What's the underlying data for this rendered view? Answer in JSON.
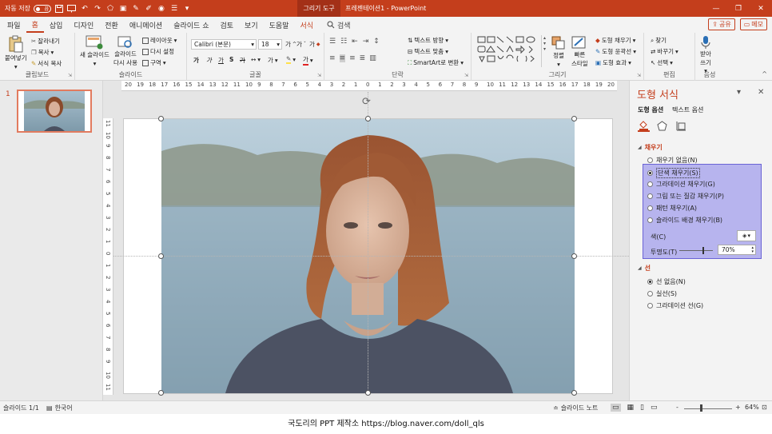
{
  "titlebar": {
    "autosave_label": "자동 저장",
    "autosave_state": "끔",
    "context_tab": "그리기 도구",
    "document_title": "프레젠테이션1 - PowerPoint",
    "window_buttons": [
      "—",
      "❐",
      "✕"
    ]
  },
  "tabs": {
    "items": [
      "파일",
      "홈",
      "삽입",
      "디자인",
      "전환",
      "애니메이션",
      "슬라이드 쇼",
      "검토",
      "보기",
      "도움말",
      "서식"
    ],
    "active": "홈",
    "context": "서식",
    "search_label": "검색",
    "share_label": "공유",
    "comments_label": "메모"
  },
  "ribbon": {
    "clipboard": {
      "label": "클립보드",
      "paste": "붙여넣기",
      "cut": "잘라내기",
      "copy": "복사",
      "format_painter": "서식 복사"
    },
    "slides": {
      "label": "슬라이드",
      "new_slide": "새 슬라이드",
      "reuse_1": "슬라이드",
      "reuse_2": "다시 사용",
      "layout": "레이아웃",
      "reset": "다시 설정",
      "section": "구역"
    },
    "font": {
      "label": "글꼴",
      "font_name": "Calibri (본문)",
      "font_size": "18",
      "grow": "가",
      "shrink": "가",
      "clear": "가",
      "bold": "가",
      "italic": "가",
      "underline": "가",
      "strike": "S",
      "char_spacing": "가",
      "change_case": "가",
      "font_color": "가"
    },
    "paragraph": {
      "label": "단락",
      "text_direction": "텍스트 방향",
      "align_text": "텍스트 맞춤",
      "smartart": "SmartArt로 변환"
    },
    "drawing": {
      "label": "그리기",
      "arrange": "정렬",
      "quick_styles_1": "빠른",
      "quick_styles_2": "스타일",
      "shape_fill": "도형 채우기",
      "shape_outline": "도형 윤곽선",
      "shape_effects": "도형 효과"
    },
    "editing": {
      "label": "편집",
      "find": "찾기",
      "replace": "바꾸기",
      "select": "선택"
    },
    "voice": {
      "label": "음성",
      "dictate_1": "받아",
      "dictate_2": "쓰기"
    }
  },
  "thumbnails": {
    "slide_number": "1"
  },
  "rulers": {
    "horizontal": [
      "20",
      "19",
      "18",
      "17",
      "16",
      "15",
      "14",
      "13",
      "12",
      "11",
      "10",
      "9",
      "8",
      "7",
      "6",
      "5",
      "4",
      "3",
      "2",
      "1",
      "0",
      "1",
      "2",
      "3",
      "4",
      "5",
      "6",
      "7",
      "8",
      "9",
      "10",
      "11",
      "12",
      "13",
      "14",
      "15",
      "16",
      "17",
      "18",
      "19",
      "20"
    ],
    "vertical": [
      "11",
      "10",
      "9",
      "8",
      "7",
      "6",
      "5",
      "4",
      "3",
      "2",
      "1",
      "0",
      "1",
      "2",
      "3",
      "4",
      "5",
      "6",
      "7",
      "8",
      "9",
      "10",
      "11"
    ]
  },
  "format_pane": {
    "title": "도형 서식",
    "tab_shape": "도형 옵션",
    "tab_text": "텍스트 옵션",
    "fill_section": "채우기",
    "fill_options": [
      {
        "label": "채우기 없음(N)",
        "checked": false
      },
      {
        "label": "단색 채우기(S)",
        "checked": true
      },
      {
        "label": "그라데이션 채우기(G)",
        "checked": false
      },
      {
        "label": "그림 또는 질감 채우기(P)",
        "checked": false
      },
      {
        "label": "패턴 채우기(A)",
        "checked": false
      },
      {
        "label": "슬라이드 배경 채우기(B)",
        "checked": false
      }
    ],
    "color_label": "색(C)",
    "transparency_label": "투명도(T)",
    "transparency_value": "70%",
    "line_section": "선",
    "line_options": [
      {
        "label": "선 없음(N)",
        "checked": true
      },
      {
        "label": "실선(S)",
        "checked": false
      },
      {
        "label": "그라데이션 선(G)",
        "checked": false
      }
    ],
    "accent_color": "#c43e1c",
    "highlight_color": "#b7b4ee"
  },
  "status": {
    "slide_info": "슬라이드 1/1",
    "language": "한국어",
    "notes": "슬라이드 노트",
    "zoom_minus": "-",
    "zoom_plus": "+",
    "zoom": "64%"
  },
  "credit": "국도리의 PPT 제작소 https://blog.naver.com/doll_qls"
}
